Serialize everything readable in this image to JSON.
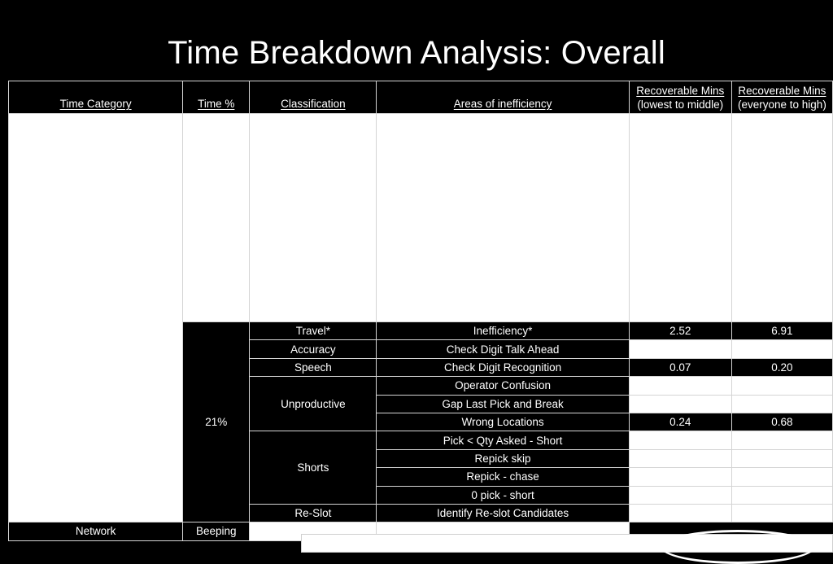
{
  "slide": {
    "title": "Time Breakdown Analysis: Overall",
    "background_color": "#000000",
    "text_color": "#ffffff",
    "grid_color": "#d4d4d4"
  },
  "table": {
    "headers": [
      {
        "label": "Time Category",
        "sub": ""
      },
      {
        "label": "Time %",
        "sub": ""
      },
      {
        "label": "Classification",
        "sub": ""
      },
      {
        "label": "Areas of inefficiency",
        "sub": ""
      },
      {
        "label": "Recoverable Mins",
        "sub": "(lowest to middle)"
      },
      {
        "label": "Recoverable Mins",
        "sub": "(everyone to high)"
      }
    ],
    "time_category": "",
    "time_percent": "21%",
    "rows": [
      {
        "classification": "Travel*",
        "area": "Inefficiency*",
        "recoverable_low_to_mid": "2.52",
        "recoverable_everyone_to_high": "6.91"
      },
      {
        "classification": "Accuracy",
        "area": "Check Digit Talk Ahead",
        "recoverable_low_to_mid": "",
        "recoverable_everyone_to_high": ""
      },
      {
        "classification": "Speech",
        "area": "Check Digit Recognition",
        "recoverable_low_to_mid": "0.07",
        "recoverable_everyone_to_high": "0.20"
      },
      {
        "classification": "Unproductive",
        "area": "Operator Confusion",
        "recoverable_low_to_mid": "",
        "recoverable_everyone_to_high": ""
      },
      {
        "classification": "",
        "area": "Gap Last Pick and Break",
        "recoverable_low_to_mid": "",
        "recoverable_everyone_to_high": ""
      },
      {
        "classification": "",
        "area": "Wrong Locations",
        "recoverable_low_to_mid": "0.24",
        "recoverable_everyone_to_high": "0.68"
      },
      {
        "classification": "Shorts",
        "area": "Pick < Qty Asked - Short",
        "recoverable_low_to_mid": "",
        "recoverable_everyone_to_high": ""
      },
      {
        "classification": "",
        "area": "Repick skip",
        "recoverable_low_to_mid": "",
        "recoverable_everyone_to_high": ""
      },
      {
        "classification": "",
        "area": "Repick - chase",
        "recoverable_low_to_mid": "",
        "recoverable_everyone_to_high": ""
      },
      {
        "classification": "",
        "area": "0 pick - short",
        "recoverable_low_to_mid": "",
        "recoverable_everyone_to_high": ""
      },
      {
        "classification": "Re-Slot",
        "area": "Identify Re-slot Candidates",
        "recoverable_low_to_mid": "",
        "recoverable_everyone_to_high": ""
      },
      {
        "classification": "Network",
        "area": "Beeping",
        "recoverable_low_to_mid": "",
        "recoverable_everyone_to_high": ""
      }
    ]
  },
  "annotations": {
    "bottom_bar_label": "",
    "ellipse_label": ""
  }
}
